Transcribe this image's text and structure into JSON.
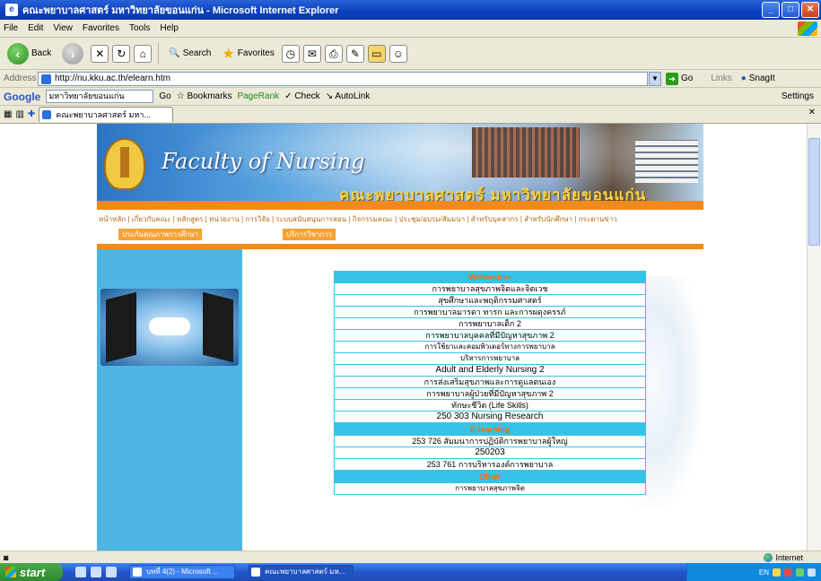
{
  "window": {
    "title": "คณะพยาบาลศาสตร์ มหาวิทยาลัยขอนแก่น - Microsoft Internet Explorer"
  },
  "menu": [
    "File",
    "Edit",
    "View",
    "Favorites",
    "Tools",
    "Help"
  ],
  "toolbar": {
    "back_label": "Back",
    "search_label": "Search",
    "favorites_label": "Favorites"
  },
  "address": {
    "label": "Address",
    "url": "http://nu.kku.ac.th/elearn.htm",
    "go_label": "Go",
    "links_label": "Links",
    "snagit_label": "SnagIt"
  },
  "google": {
    "logo": "Google",
    "search_value": "มหาวิทยาลัยขอนแก่น",
    "go_label": "Go",
    "bookmarks_label": "Bookmarks",
    "pagerank_label": "PageRank",
    "check_label": "Check",
    "autolink_label": "AutoLink",
    "settings_label": "Settings"
  },
  "tab": {
    "label": "คณะพยาบาลศาสตร์ มหา..."
  },
  "banner": {
    "faculty_text": "Faculty of Nursing",
    "thai_title": "คณะพยาบาลศาสตร์ มหาวิทยาลัยขอนแก่น"
  },
  "topnav": {
    "row1": "หน้าหลัก | เกี่ยวกับคณะ | หลักสูตร | หน่วยงาน | การวิจัย | ระบบสนับสนุนการสอน | กิจกรรมคณะ | ประชุม/อบรม/สัมมนา | สำหรับบุคลากร | สำหรับนักศึกษา | กระดานข่าว",
    "row2": [
      "ประกันคุณภาพการศึกษา",
      "บริการวิชาการ"
    ]
  },
  "courses": {
    "section1_header": "Webcourse",
    "section1": [
      "การพยาบาลสุขภาพจิตและจิตเวช",
      "สุขศึกษาและพฤติกรรมศาสตร์",
      "การพยาบาลมารดา ทารก และการผดุงครรภ์",
      "การพยาบาลเด็ก 2",
      "การพยาบาลบุคคลที่มีปัญหาสุขภาพ 2",
      "การใช้ยาและคอมพิวเตอร์ทางการพยาบาล",
      "บริหารการพยาบาล",
      "Adult and Elderly Nursing 2",
      "การส่งเสริมสุขภาพและการดูแลตนเอง",
      "การพยาบาลผู้ป่วยที่มีปัญหาสุขภาพ 2",
      "ทักษะชีวิต (Life Skills)",
      "250 303 Nursing Research"
    ],
    "section2_header": "E-learning",
    "section2": [
      "253 726 สัมมนาการปฏิบัติการพยาบาลผู้ใหญ่",
      "250203",
      "253 761 การบริหารองค์การพยาบาล"
    ],
    "section3_header": "Other",
    "section3": [
      "การพยาบาลสุขภาพจิต"
    ]
  },
  "status": {
    "zone_label": "Internet"
  },
  "taskbar": {
    "start_label": "start",
    "task1": "บทที่ 4(2) - Microsoft ...",
    "task2": "คณะพยาบาลศาสตร์ มห...",
    "tray_lang": "EN"
  }
}
